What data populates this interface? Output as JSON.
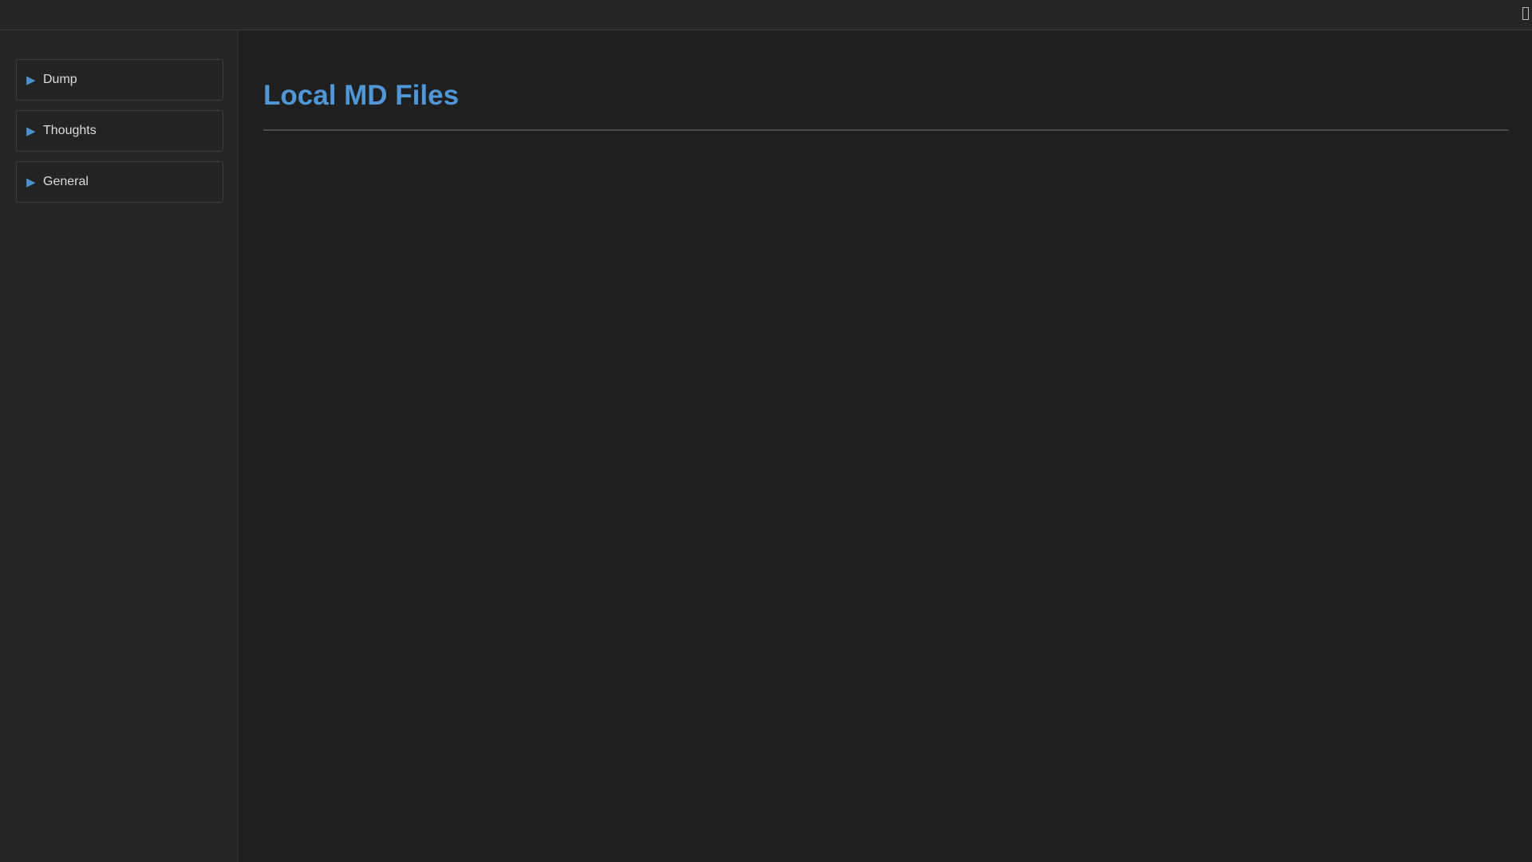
{
  "topbar": {
    "icon": "window-toggle-icon"
  },
  "sidebar": {
    "items": [
      {
        "label": "Dump",
        "icon": "play-arrow-icon",
        "arrow": "▶"
      },
      {
        "label": "Thoughts",
        "icon": "play-arrow-icon",
        "arrow": "▶"
      },
      {
        "label": "General",
        "icon": "play-arrow-icon",
        "arrow": "▶"
      }
    ]
  },
  "main": {
    "title": "Local MD Files"
  },
  "colors": {
    "accent": "#4f97d6",
    "background": "#1f1f1f",
    "sidebar": "#252525"
  }
}
